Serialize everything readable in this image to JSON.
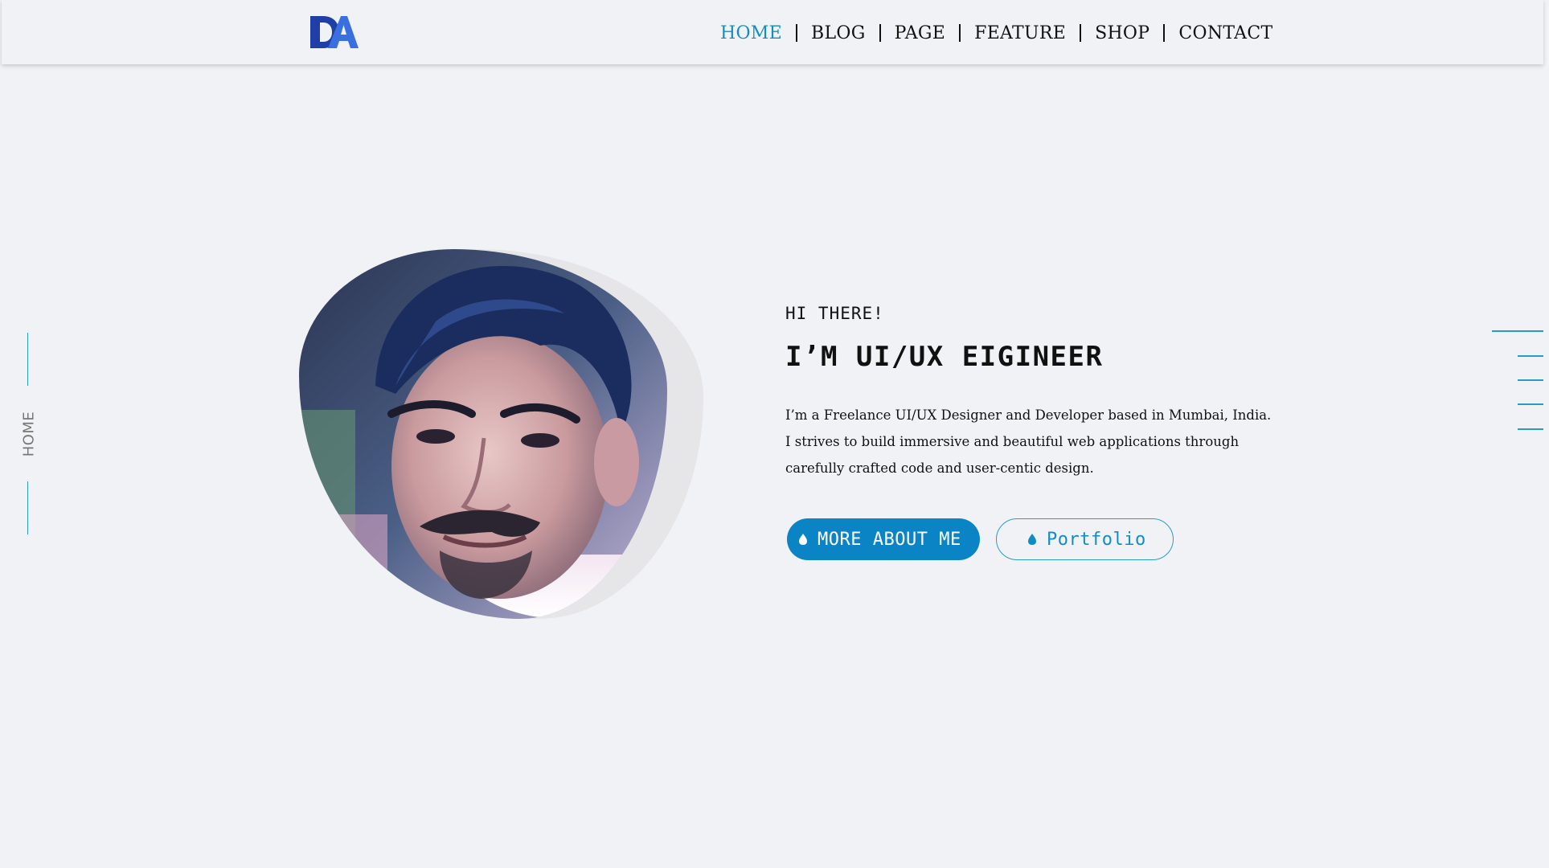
{
  "brand": {
    "logo_text": "DA",
    "logo_color_dark": "#1f3fa6",
    "logo_color_light": "#3a6fe0"
  },
  "nav": {
    "items": [
      {
        "label": "HOME",
        "active": true
      },
      {
        "label": "BLOG",
        "active": false
      },
      {
        "label": "PAGE",
        "active": false
      },
      {
        "label": "FEATURE",
        "active": false
      },
      {
        "label": "SHOP",
        "active": false
      },
      {
        "label": "CONTACT",
        "active": false
      }
    ]
  },
  "side_rail": {
    "label": "HOME"
  },
  "hero": {
    "greeting": "HI THERE!",
    "headline": "I’M UI/UX EIGINEER",
    "description_lines": [
      "I’m a Freelance UI/UX Designer and Developer based in Mumbai, India.",
      "I strives to build immersive and beautiful web applications through",
      "carefully crafted code and user-centic design."
    ],
    "primary_button": {
      "label": "MORE ABOUT ME",
      "icon": "drop-icon"
    },
    "secondary_button": {
      "label": "Portfolio",
      "icon": "drop-icon"
    }
  },
  "colors": {
    "accent": "#0f8ec4",
    "button": "#0a84c5",
    "background": "#f1f2f6"
  }
}
